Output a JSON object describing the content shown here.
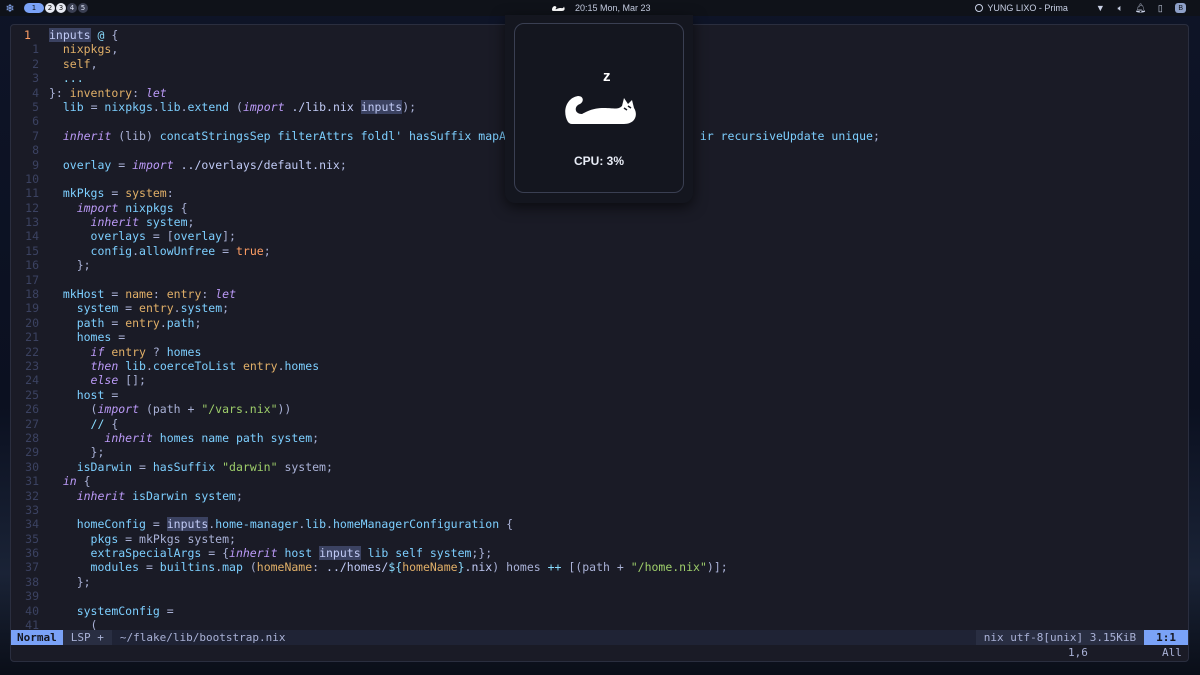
{
  "topbar": {
    "workspaces": [
      "1",
      "2",
      "3",
      "4",
      "5"
    ],
    "active_workspace": "1",
    "clock": "20:15 Mon, Mar 23",
    "media": "YUNG LIXO - Prima",
    "badge": "B"
  },
  "popup": {
    "z_text": "z",
    "cpu_text": "CPU: 3%"
  },
  "editor": {
    "lines": [
      {
        "n": "1",
        "html": "<span class=\"hl\">inputs</span> <span class=\"o\">@</span> {"
      },
      {
        "n": "1",
        "html": "  <span class=\"c\">nixpkgs</span>,"
      },
      {
        "n": "2",
        "html": "  <span class=\"c\">self</span>,"
      },
      {
        "n": "3",
        "html": "  <span class=\"o\">...</span>"
      },
      {
        "n": "4",
        "html": "}: <span class=\"c\">inventory</span>: <span class=\"k\">let</span>"
      },
      {
        "n": "5",
        "html": "  <span class=\"v\">lib</span> = <span class=\"v\">nixpkgs</span>.<span class=\"v\">lib</span>.<span class=\"v\">extend</span> (<span class=\"k\">import</span> <span class=\"t\">./lib.nix</span> <span class=\"hl\">inputs</span>);"
      },
      {
        "n": "6",
        "html": ""
      },
      {
        "n": "7",
        "html": "  <span class=\"k\">inherit</span> (lib) <span class=\"v\">concatStringsSep filterAttrs foldl' hasSuffix mapAttrs</span>                        <span class=\"v\">ir recursiveUpdate unique</span>;"
      },
      {
        "n": "8",
        "html": ""
      },
      {
        "n": "9",
        "html": "  <span class=\"v\">overlay</span> = <span class=\"k\">import</span> <span class=\"t\">../overlays/default.nix</span>;"
      },
      {
        "n": "10",
        "html": ""
      },
      {
        "n": "11",
        "html": "  <span class=\"v\">mkPkgs</span> = <span class=\"c\">system</span>:"
      },
      {
        "n": "12",
        "html": "    <span class=\"k\">import</span> <span class=\"v\">nixpkgs</span> {"
      },
      {
        "n": "13",
        "html": "      <span class=\"k\">inherit</span> <span class=\"v\">system</span>;"
      },
      {
        "n": "14",
        "html": "      <span class=\"v\">overlays</span> = [<span class=\"v\">overlay</span>];"
      },
      {
        "n": "15",
        "html": "      <span class=\"v\">config</span>.<span class=\"v\">allowUnfree</span> = <span class=\"b\">true</span>;"
      },
      {
        "n": "16",
        "html": "    };"
      },
      {
        "n": "17",
        "html": ""
      },
      {
        "n": "18",
        "html": "  <span class=\"v\">mkHost</span> = <span class=\"c\">name</span>: <span class=\"c\">entry</span>: <span class=\"k\">let</span>"
      },
      {
        "n": "19",
        "html": "    <span class=\"v\">system</span> = <span class=\"c\">entry</span>.<span class=\"v\">system</span>;"
      },
      {
        "n": "20",
        "html": "    <span class=\"v\">path</span> = <span class=\"c\">entry</span>.<span class=\"v\">path</span>;"
      },
      {
        "n": "21",
        "html": "    <span class=\"v\">homes</span> ="
      },
      {
        "n": "22",
        "html": "      <span class=\"k\">if</span> <span class=\"c\">entry</span> ? <span class=\"v\">homes</span>"
      },
      {
        "n": "23",
        "html": "      <span class=\"k\">then</span> <span class=\"v\">lib</span>.<span class=\"v\">coerceToList</span> <span class=\"c\">entry</span>.<span class=\"v\">homes</span>"
      },
      {
        "n": "24",
        "html": "      <span class=\"k\">else</span> [];"
      },
      {
        "n": "25",
        "html": "    <span class=\"v\">host</span> ="
      },
      {
        "n": "26",
        "html": "      (<span class=\"k\">import</span> (path + <span class=\"s\">\"/vars.nix\"</span>))"
      },
      {
        "n": "27",
        "html": "      <span class=\"o\">//</span> {"
      },
      {
        "n": "28",
        "html": "        <span class=\"k\">inherit</span> <span class=\"v\">homes name path system</span>;"
      },
      {
        "n": "29",
        "html": "      };"
      },
      {
        "n": "30",
        "html": "    <span class=\"v\">isDarwin</span> = <span class=\"v\">hasSuffix</span> <span class=\"s\">\"darwin\"</span> system;"
      },
      {
        "n": "31",
        "html": "  <span class=\"k\">in</span> {"
      },
      {
        "n": "32",
        "html": "    <span class=\"k\">inherit</span> <span class=\"v\">isDarwin system</span>;"
      },
      {
        "n": "33",
        "html": ""
      },
      {
        "n": "34",
        "html": "    <span class=\"v\">homeConfig</span> = <span class=\"hl\">inputs</span>.<span class=\"v\">home-manager</span>.<span class=\"v\">lib</span>.<span class=\"v\">homeManagerConfiguration</span> {"
      },
      {
        "n": "35",
        "html": "      <span class=\"v\">pkgs</span> = mkPkgs system;"
      },
      {
        "n": "36",
        "html": "      <span class=\"v\">extraSpecialArgs</span> = {<span class=\"k\">inherit</span> <span class=\"v\">host</span> <span class=\"hl\">inputs</span> <span class=\"v\">lib self system</span>;};"
      },
      {
        "n": "37",
        "html": "      <span class=\"v\">modules</span> = <span class=\"v\">builtins</span>.<span class=\"v\">map</span> (<span class=\"c\">homeName</span>: <span class=\"t\">../homes/</span><span class=\"o\">${</span><span class=\"c\">homeName</span><span class=\"o\">}</span><span class=\"t\">.nix</span>) homes <span class=\"o\">++</span> [(path + <span class=\"s\">\"/home.nix\"</span>)];"
      },
      {
        "n": "38",
        "html": "    };"
      },
      {
        "n": "39",
        "html": ""
      },
      {
        "n": "40",
        "html": "    <span class=\"v\">systemConfig</span> ="
      },
      {
        "n": "41",
        "html": "      ("
      }
    ],
    "statusline": {
      "mode": "Normal",
      "lsp": "LSP +",
      "file": "~/flake/lib/bootstrap.nix",
      "fileinfo": "nix utf-8[unix] 3.15KiB",
      "position": "1:1"
    },
    "cmdline": {
      "pos": "1,6",
      "scroll": "All"
    }
  }
}
